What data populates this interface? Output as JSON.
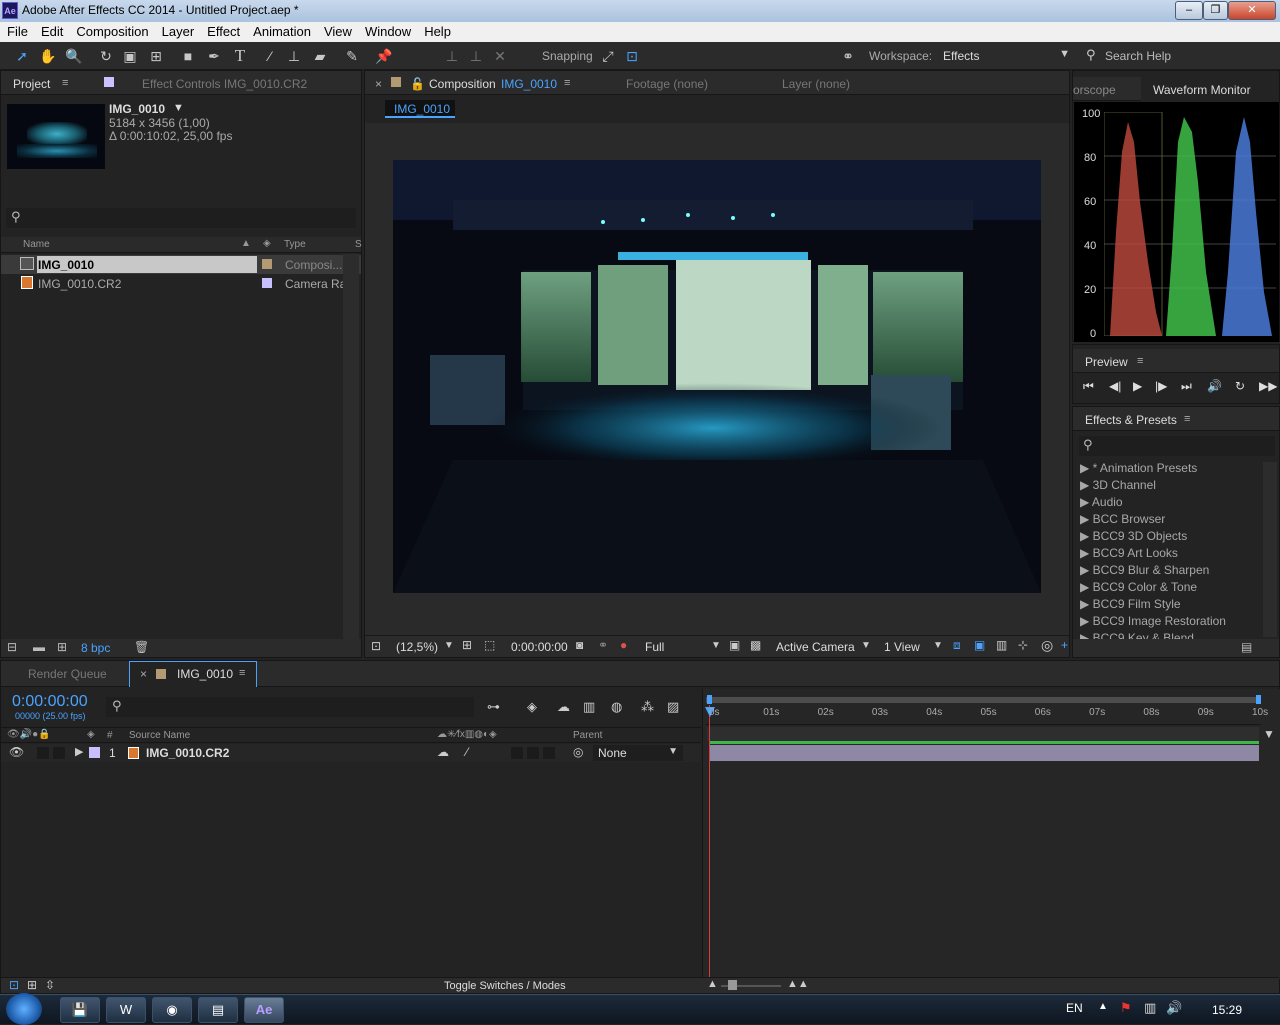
{
  "window": {
    "title": "Adobe After Effects CC 2014 - Untitled Project.aep *",
    "app_icon": "Ae"
  },
  "menu": [
    "File",
    "Edit",
    "Composition",
    "Layer",
    "Effect",
    "Animation",
    "View",
    "Window",
    "Help"
  ],
  "toolbar": {
    "snapping": "Snapping",
    "workspace_label": "Workspace:",
    "workspace_value": "Effects",
    "search_placeholder": "Search Help"
  },
  "project": {
    "tab": "Project",
    "effect_controls_tab": "Effect Controls IMG_0010.CR2",
    "item_name": "IMG_0010",
    "item_dims": "5184 x 3456 (1,00)",
    "item_duration": "Δ 0:00:10:02, 25,00 fps",
    "col_name": "Name",
    "col_type": "Type",
    "col_s": "S",
    "items": [
      {
        "name": "IMG_0010",
        "type": "Composi..."
      },
      {
        "name": "IMG_0010.CR2",
        "type": "Camera Raw"
      }
    ],
    "bpc": "8 bpc"
  },
  "composition": {
    "tab_prefix": "Composition",
    "tab_name": "IMG_0010",
    "footage_tab": "Footage (none)",
    "layer_tab": "Layer (none)",
    "flow_tab": "IMG_0010",
    "zoom": "(12,5%)",
    "timecode": "0:00:00:00",
    "resolution": "Full",
    "camera": "Active Camera",
    "views": "1 View"
  },
  "scopes": {
    "tab_partial": "orscope",
    "tab": "Waveform Monitor",
    "axis": [
      "100",
      "80",
      "60",
      "40",
      "20",
      "0"
    ]
  },
  "preview": {
    "tab": "Preview"
  },
  "effects": {
    "tab": "Effects & Presets",
    "items": [
      "* Animation Presets",
      "3D Channel",
      "Audio",
      "BCC Browser",
      "BCC9 3D Objects",
      "BCC9 Art Looks",
      "BCC9 Blur & Sharpen",
      "BCC9 Color & Tone",
      "BCC9 Film Style",
      "BCC9 Image Restoration",
      "BCC9 Key & Blend"
    ]
  },
  "timeline": {
    "render_queue_tab": "Render Queue",
    "comp_tab": "IMG_0010",
    "timecode": "0:00:00:00",
    "frames": "00000 (25.00 fps)",
    "col_source": "Source Name",
    "col_parent": "Parent",
    "layer_num": "1",
    "layer_name": "IMG_0010.CR2",
    "parent_value": "None",
    "ticks": [
      "0s",
      "01s",
      "02s",
      "03s",
      "04s",
      "05s",
      "06s",
      "07s",
      "08s",
      "09s",
      "10s"
    ],
    "toggle": "Toggle Switches / Modes"
  },
  "taskbar": {
    "lang": "EN",
    "time": "15:29"
  }
}
